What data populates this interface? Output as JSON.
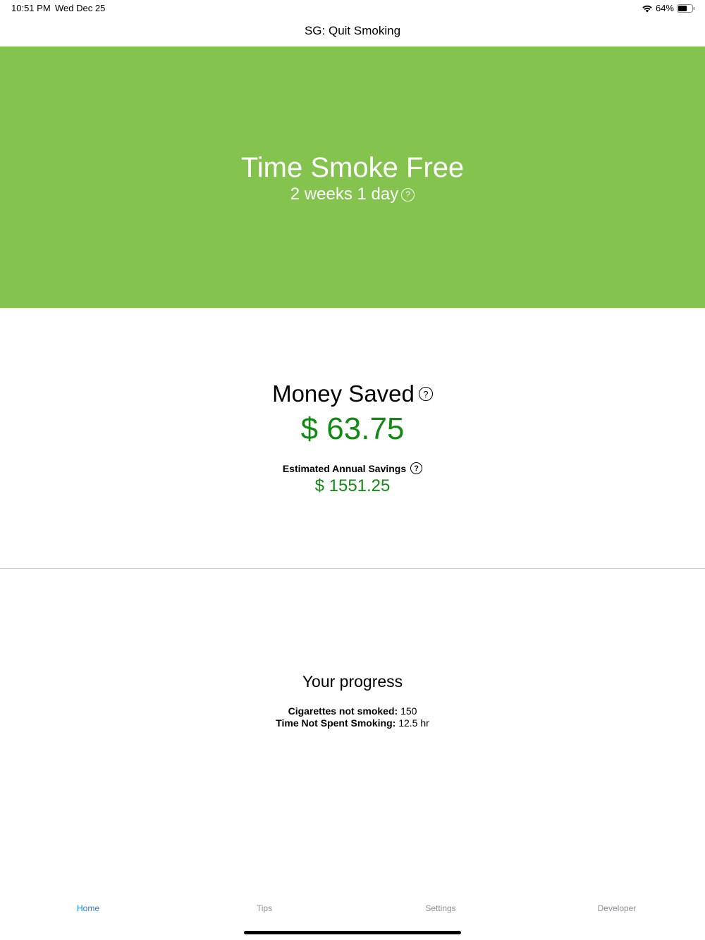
{
  "status_bar": {
    "time": "10:51 PM",
    "date": "Wed Dec 25",
    "battery_percent": "64%",
    "battery_level": 0.64,
    "icons": [
      "wifi-icon",
      "battery-icon"
    ]
  },
  "nav": {
    "title": "SG: Quit Smoking"
  },
  "hero": {
    "title": "Time Smoke Free",
    "duration": "2 weeks 1 day",
    "help_glyph": "?",
    "background_color": "#83c34e"
  },
  "money": {
    "title": "Money Saved",
    "help_glyph": "?",
    "value": "$ 63.75",
    "annual_label": "Estimated Annual Savings",
    "annual_help_glyph": "?",
    "annual_value": "$ 1551.25",
    "value_color": "#138a13"
  },
  "progress": {
    "title": "Your progress",
    "cigarettes_label": "Cigarettes not smoked:",
    "cigarettes_value": "150",
    "time_label": "Time Not Spent Smoking:",
    "time_value": "12.5 hr"
  },
  "tabs": [
    {
      "label": "Home",
      "active": true
    },
    {
      "label": "Tips",
      "active": false
    },
    {
      "label": "Settings",
      "active": false
    },
    {
      "label": "Developer",
      "active": false
    }
  ],
  "colors": {
    "accent": "#1a82f0",
    "tab_inactive": "#8e8e93"
  }
}
